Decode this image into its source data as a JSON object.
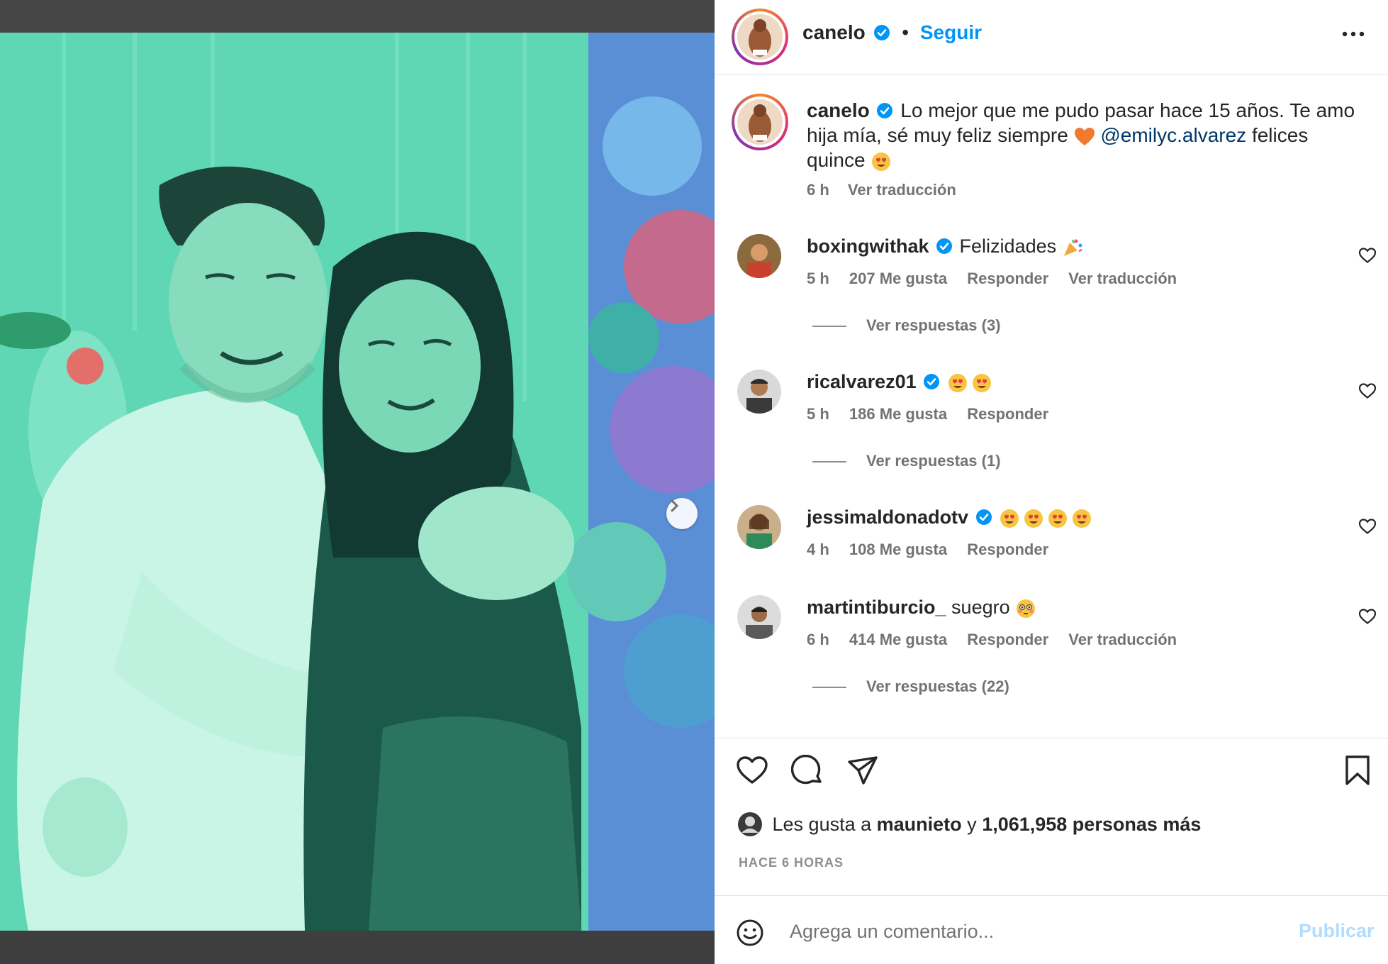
{
  "post": {
    "author": "canelo",
    "follow_label": "Seguir",
    "separator": "•",
    "more_icon": "more-horizontal-icon",
    "photo_carousel": {
      "current": 1,
      "total": 2
    }
  },
  "caption": {
    "username": "canelo",
    "text_1": "Lo mejor que me pudo pasar hace 15 años. Te amo hija mía, sé muy feliz siempre",
    "mention": "@emilyc.alvarez",
    "text_2": "felices quince",
    "time": "6 h",
    "translate": "Ver traducción"
  },
  "comments": [
    {
      "username": "boxingwithak",
      "text": "Felizidades",
      "emoji": "party-popper",
      "time": "5 h",
      "likes": "207 Me gusta",
      "reply": "Responder",
      "translate": "Ver traducción",
      "replies": "Ver respuestas (3)"
    },
    {
      "username": "ricalvarez01",
      "text": "",
      "emoji": "heart-eyes x2",
      "time": "5 h",
      "likes": "186 Me gusta",
      "reply": "Responder",
      "translate": "",
      "replies": "Ver respuestas (1)"
    },
    {
      "username": "jessimaldonadotv",
      "text": "",
      "emoji": "heart-eyes x4",
      "time": "4 h",
      "likes": "108 Me gusta",
      "reply": "Responder",
      "translate": "",
      "replies": ""
    },
    {
      "username": "martintiburcio_",
      "text": "suegro",
      "emoji": "flushed-face",
      "time": "6 h",
      "likes": "414 Me gusta",
      "reply": "Responder",
      "translate": "Ver traducción",
      "replies": "Ver respuestas (22)"
    }
  ],
  "likes_line": {
    "prefix": "Les gusta a",
    "user": "maunieto",
    "middle": "y",
    "count": "1,061,958 personas más"
  },
  "posted_time": "HACE 6 HORAS",
  "composer": {
    "placeholder": "Agrega un comentario...",
    "publish": "Publicar"
  },
  "colors": {
    "follow_blue": "#0095f6",
    "verified_blue": "#0095f6",
    "photo_tint": "#4cc7a6",
    "publish_disabled": "#b3dbff"
  }
}
